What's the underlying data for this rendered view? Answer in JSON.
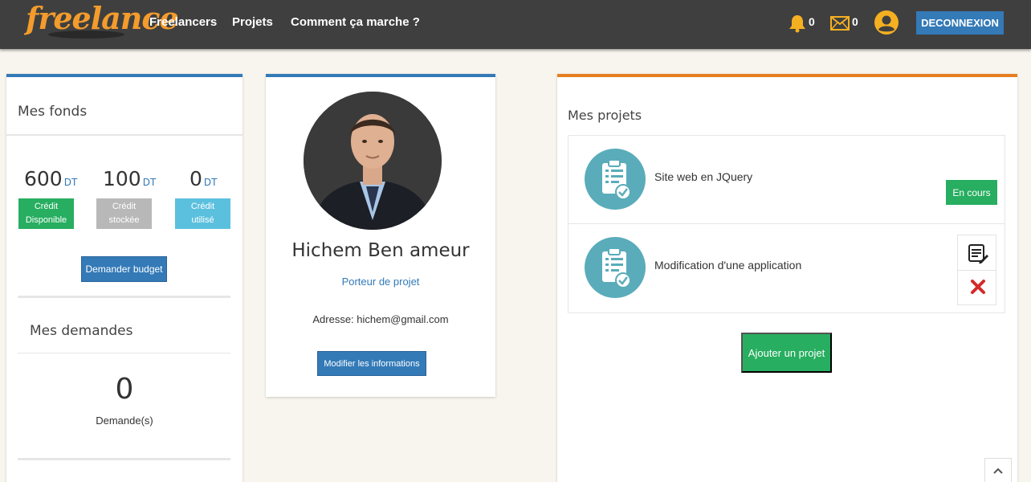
{
  "nav": {
    "logo": "freelance",
    "links": [
      "Freelancers",
      "Projets",
      "Comment ça marche ?"
    ],
    "notifications_count": "0",
    "messages_count": "0",
    "logout_label": "DECONNEXION"
  },
  "funds": {
    "title": "Mes fonds",
    "items": [
      {
        "amount": "600",
        "unit": "DT",
        "label_line1": "Crédit",
        "label_line2": "Disponible",
        "color": "#27ae60"
      },
      {
        "amount": "100",
        "unit": "DT",
        "label_line1": "Crédit",
        "label_line2": "stockée",
        "color": "#b8b8b8"
      },
      {
        "amount": "0",
        "unit": "DT",
        "label_line1": "Crédit",
        "label_line2": "utilisé",
        "color": "#5bc0de"
      }
    ],
    "request_budget_label": "Demander budget"
  },
  "requests": {
    "title": "Mes demandes",
    "count": "0",
    "label": "Demande(s)"
  },
  "profile": {
    "name": "Hichem Ben ameur",
    "role": "Porteur de projet",
    "address": "Adresse: hichem@gmail.com",
    "edit_label": "Modifier les informations"
  },
  "projects": {
    "title": "Mes projets",
    "items": [
      {
        "title": "Site web en JQuery",
        "status": "En cours"
      },
      {
        "title": "Modification d'une application"
      }
    ],
    "add_label": "Ajouter un projet"
  },
  "colors": {
    "accent_blue": "#337ab7",
    "accent_orange": "#e67e22",
    "success_green": "#27ae60",
    "icon_teal": "#5aacba"
  }
}
